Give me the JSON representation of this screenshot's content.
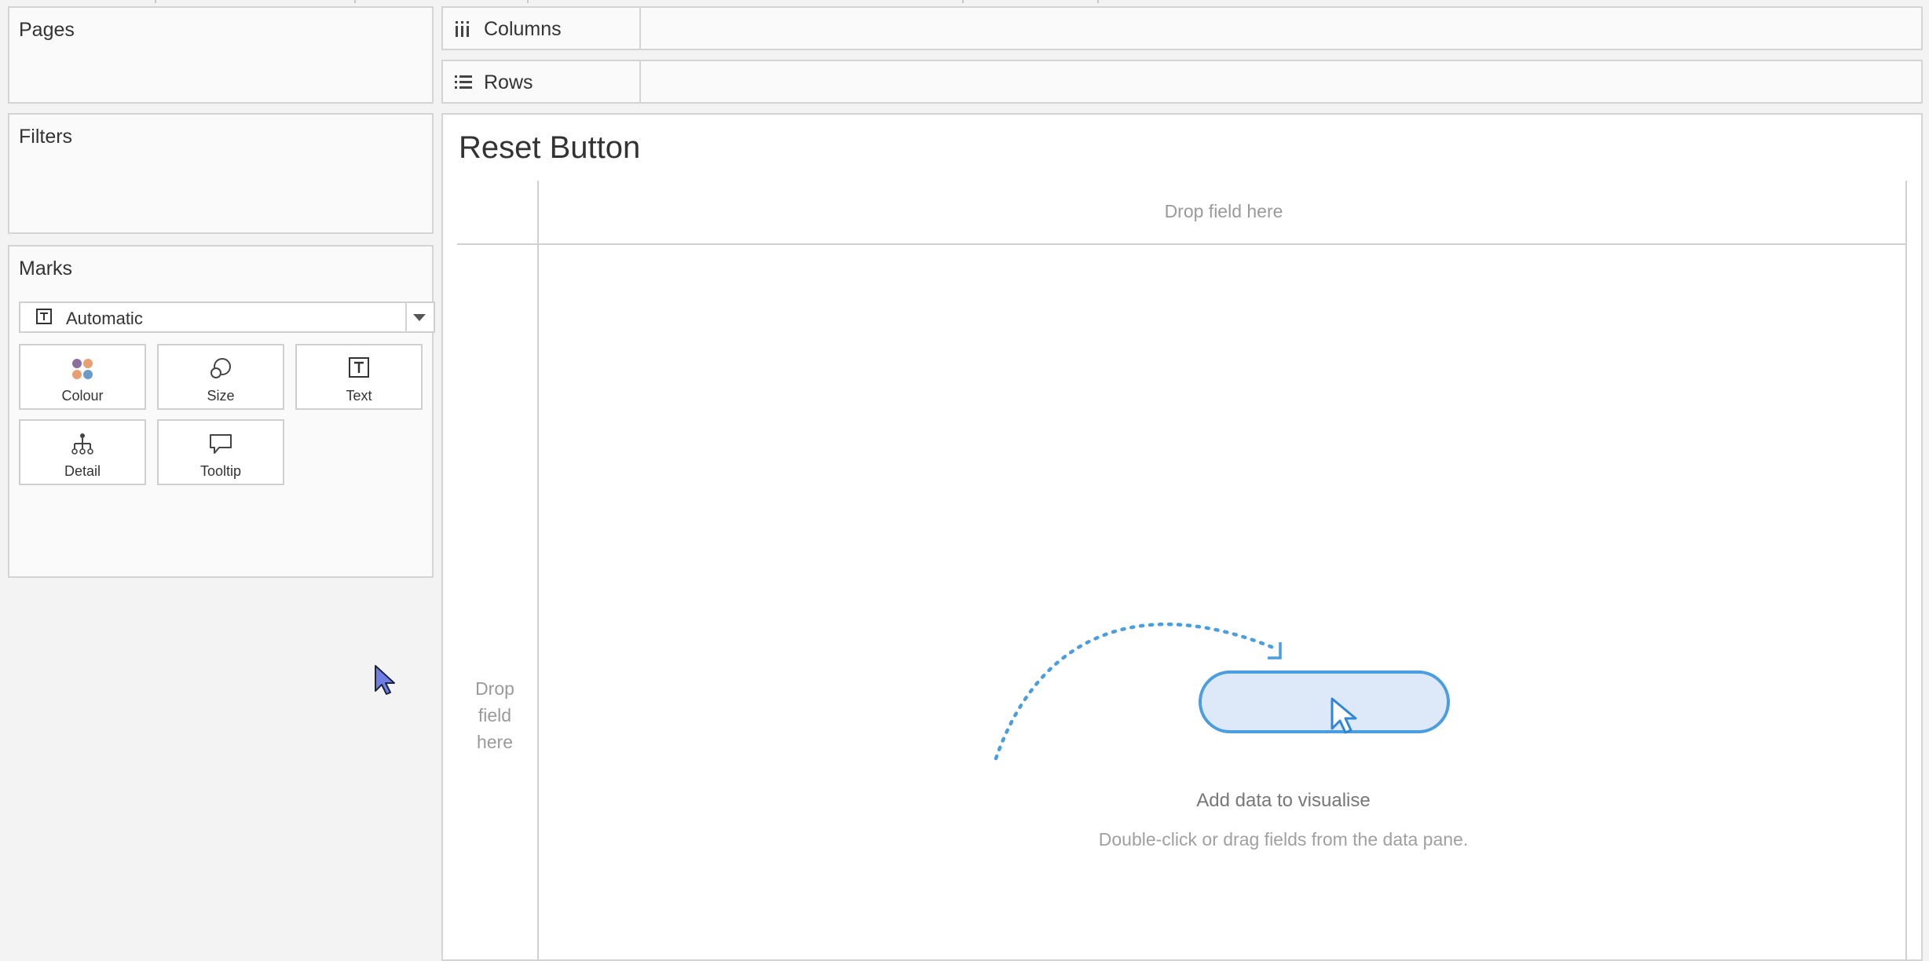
{
  "sidebar": {
    "pages": {
      "title": "Pages"
    },
    "filters": {
      "title": "Filters"
    },
    "marks": {
      "title": "Marks",
      "mark_type": "Automatic",
      "buttons": [
        {
          "label": "Colour",
          "icon": "colour-dots-icon"
        },
        {
          "label": "Size",
          "icon": "size-circles-icon"
        },
        {
          "label": "Text",
          "icon": "text-t-icon"
        },
        {
          "label": "Detail",
          "icon": "detail-hierarchy-icon"
        },
        {
          "label": "Tooltip",
          "icon": "speech-bubble-icon"
        }
      ]
    }
  },
  "shelves": {
    "columns": {
      "label": "Columns",
      "icon": "columns-icon"
    },
    "rows": {
      "label": "Rows",
      "icon": "rows-icon"
    }
  },
  "canvas": {
    "title": "Reset Button",
    "drop_columns": "Drop field here",
    "drop_rows": "Drop field here",
    "empty_title": "Add data to visualise",
    "empty_subtitle": "Double-click or drag fields from the data pane."
  },
  "colors": {
    "accent_blue": "#4a9ee0",
    "pill_fill": "#dde9f9",
    "mouse_cursor": "#6d7fe6"
  }
}
